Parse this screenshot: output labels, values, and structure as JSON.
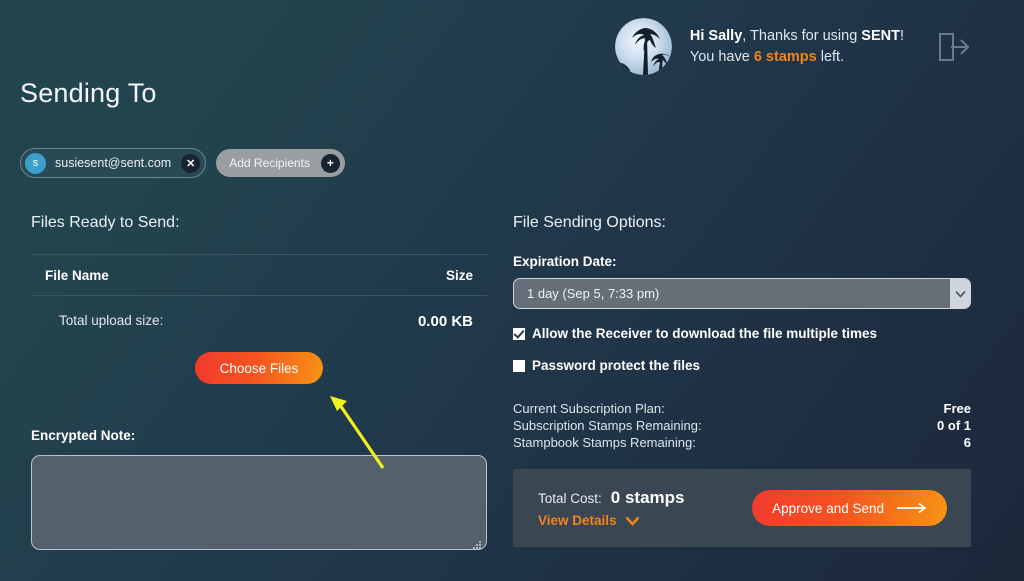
{
  "header": {
    "avatar_name": "palm-tree-avatar",
    "greeting_hi": "Hi Sally",
    "greeting_mid": ", Thanks for using ",
    "greeting_brand": "SENT",
    "greeting_excl": "!",
    "stamps_pre": "You have ",
    "stamps_count": "6 stamps",
    "stamps_post": " left.",
    "logout_icon": "logout-icon"
  },
  "page": {
    "title": "Sending To"
  },
  "recipients": {
    "chip_initial": "s",
    "chip_email": "susiesent@sent.com",
    "chip_remove": "✕",
    "add_label": "Add Recipients",
    "add_plus": "+"
  },
  "files": {
    "heading": "Files Ready to Send:",
    "columns": [
      "File Name",
      "Size"
    ],
    "total_label": "Total upload size:",
    "total_value": "0.00 KB",
    "choose_files_label": "Choose Files"
  },
  "note": {
    "label": "Encrypted Note:",
    "value": "",
    "placeholder": ""
  },
  "options": {
    "heading": "File Sending Options:",
    "expiration_label": "Expiration Date:",
    "expiration_value": "1 day (Sep 5, 7:33 pm)",
    "expiration_options": [
      "1 day (Sep 5, 7:33 pm)"
    ],
    "checkbox_download_label": "Allow the Receiver to download the file multiple times",
    "checkbox_download_checked": true,
    "checkbox_password_label": "Password protect the files",
    "checkbox_password_checked": false
  },
  "plan": {
    "rows": [
      {
        "label": "Current Subscription Plan:",
        "value": "Free"
      },
      {
        "label": "Subscription Stamps Remaining:",
        "value": "0 of 1"
      },
      {
        "label": "Stampbook Stamps Remaining:",
        "value": "6"
      }
    ]
  },
  "cost": {
    "total_label": "Total Cost:",
    "total_value": "0 stamps",
    "view_details_label": "View Details",
    "approve_label": "Approve and Send"
  },
  "colors": {
    "accent_orange": "#f0851c",
    "gradient_start": "#f23a2e",
    "gradient_end": "#f79414",
    "chip_avatar_blue": "#3ba0c9",
    "annotation_yellow": "#f2f21a",
    "bg_top_left": "#22454f",
    "bg_bottom_right": "#1d273a"
  }
}
